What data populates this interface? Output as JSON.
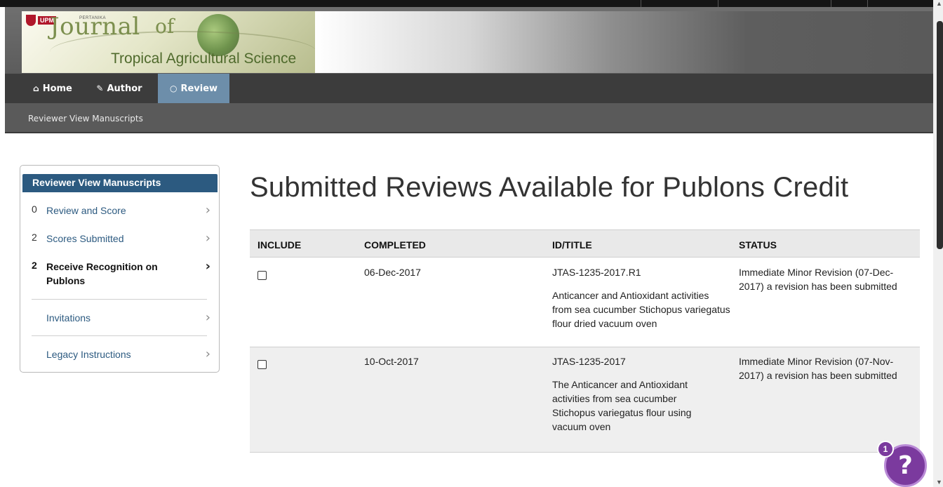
{
  "header": {
    "logo_badge": "UPM",
    "logo_small": "PERTANIKA",
    "journal_word": "Journal",
    "journal_of": "of",
    "journal_subtitle": "Tropical Agricultural Science"
  },
  "nav": {
    "items": [
      {
        "label": "Home",
        "icon": "home-icon"
      },
      {
        "label": "Author",
        "icon": "pencil-icon"
      },
      {
        "label": "Review",
        "icon": "speech-bubble-icon"
      }
    ],
    "active": "Review"
  },
  "breadcrumb": "Reviewer View Manuscripts",
  "sidebar": {
    "title": "Reviewer View Manuscripts",
    "items": [
      {
        "count": "0",
        "label": "Review and Score"
      },
      {
        "count": "2",
        "label": "Scores Submitted"
      },
      {
        "count": "2",
        "label": "Receive Recognition on Publons"
      },
      {
        "count": "",
        "label": "Invitations"
      },
      {
        "count": "",
        "label": "Legacy Instructions"
      }
    ]
  },
  "page_title": "Submitted Reviews Available for Publons Credit",
  "table": {
    "headers": [
      "INCLUDE",
      "COMPLETED",
      "ID/TITLE",
      "STATUS"
    ],
    "rows": [
      {
        "completed": "06-Dec-2017",
        "id": "JTAS-1235-2017.R1",
        "title": "Anticancer and Antioxidant activities from sea cucumber Stichopus variegatus flour dried vacuum oven",
        "status": "Immediate Minor Revision (07-Dec-2017) a revision has been submitted"
      },
      {
        "completed": "10-Oct-2017",
        "id": "JTAS-1235-2017",
        "title": "The Anticancer and Antioxidant activities from sea cucumber Stichopus variegatus flour using vacuum oven",
        "status": "Immediate Minor Revision (07-Nov-2017) a revision has been submitted"
      }
    ]
  },
  "help": {
    "badge_count": "1",
    "symbol": "?"
  },
  "colors": {
    "nav_active": "#6d8eaa",
    "sidebar_header": "#2c5a80",
    "help_widget": "#7b3a9e"
  }
}
